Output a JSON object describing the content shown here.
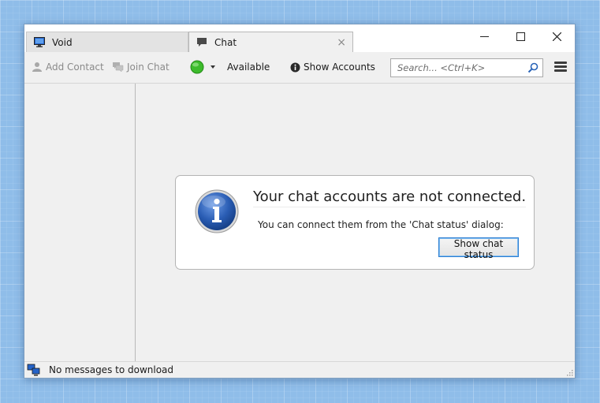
{
  "tabs": [
    {
      "label": "Void",
      "icon": "monitor-icon"
    },
    {
      "label": "Chat",
      "icon": "speech-bubble-icon",
      "active": true
    }
  ],
  "window_controls": {
    "minimize": "minimize-icon",
    "maximize": "maximize-icon",
    "close": "close-icon"
  },
  "toolbar": {
    "add_contact": "Add Contact",
    "join_chat": "Join Chat",
    "status": "Available",
    "status_color": "#3dbb2c",
    "show_accounts": "Show Accounts",
    "search_placeholder": "Search... <Ctrl+K>"
  },
  "notice": {
    "title": "Your chat accounts are not connected.",
    "description": "You can connect them from the 'Chat status' dialog:",
    "button": "Show chat status",
    "icon": "info-icon"
  },
  "statusbar": {
    "text": "No messages to download",
    "icon": "online-status-icon"
  },
  "colors": {
    "accent": "#2f7fd1",
    "info_icon": "#2a5db4"
  }
}
